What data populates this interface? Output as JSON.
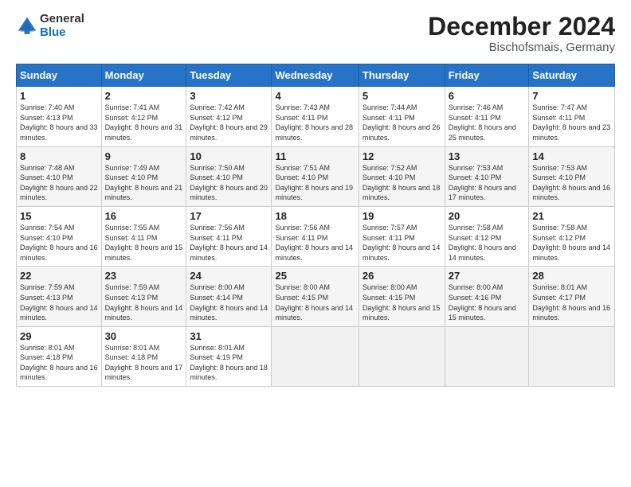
{
  "header": {
    "logo_general": "General",
    "logo_blue": "Blue",
    "title": "December 2024",
    "subtitle": "Bischofsmais, Germany"
  },
  "weekdays": [
    "Sunday",
    "Monday",
    "Tuesday",
    "Wednesday",
    "Thursday",
    "Friday",
    "Saturday"
  ],
  "weeks": [
    [
      {
        "day": "1",
        "sunrise": "7:40 AM",
        "sunset": "4:13 PM",
        "daylight": "8 hours and 33 minutes."
      },
      {
        "day": "2",
        "sunrise": "7:41 AM",
        "sunset": "4:12 PM",
        "daylight": "8 hours and 31 minutes."
      },
      {
        "day": "3",
        "sunrise": "7:42 AM",
        "sunset": "4:12 PM",
        "daylight": "8 hours and 29 minutes."
      },
      {
        "day": "4",
        "sunrise": "7:43 AM",
        "sunset": "4:11 PM",
        "daylight": "8 hours and 28 minutes."
      },
      {
        "day": "5",
        "sunrise": "7:44 AM",
        "sunset": "4:11 PM",
        "daylight": "8 hours and 26 minutes."
      },
      {
        "day": "6",
        "sunrise": "7:46 AM",
        "sunset": "4:11 PM",
        "daylight": "8 hours and 25 minutes."
      },
      {
        "day": "7",
        "sunrise": "7:47 AM",
        "sunset": "4:11 PM",
        "daylight": "8 hours and 23 minutes."
      }
    ],
    [
      {
        "day": "8",
        "sunrise": "7:48 AM",
        "sunset": "4:10 PM",
        "daylight": "8 hours and 22 minutes."
      },
      {
        "day": "9",
        "sunrise": "7:49 AM",
        "sunset": "4:10 PM",
        "daylight": "8 hours and 21 minutes."
      },
      {
        "day": "10",
        "sunrise": "7:50 AM",
        "sunset": "4:10 PM",
        "daylight": "8 hours and 20 minutes."
      },
      {
        "day": "11",
        "sunrise": "7:51 AM",
        "sunset": "4:10 PM",
        "daylight": "8 hours and 19 minutes."
      },
      {
        "day": "12",
        "sunrise": "7:52 AM",
        "sunset": "4:10 PM",
        "daylight": "8 hours and 18 minutes."
      },
      {
        "day": "13",
        "sunrise": "7:53 AM",
        "sunset": "4:10 PM",
        "daylight": "8 hours and 17 minutes."
      },
      {
        "day": "14",
        "sunrise": "7:53 AM",
        "sunset": "4:10 PM",
        "daylight": "8 hours and 16 minutes."
      }
    ],
    [
      {
        "day": "15",
        "sunrise": "7:54 AM",
        "sunset": "4:10 PM",
        "daylight": "8 hours and 16 minutes."
      },
      {
        "day": "16",
        "sunrise": "7:55 AM",
        "sunset": "4:11 PM",
        "daylight": "8 hours and 15 minutes."
      },
      {
        "day": "17",
        "sunrise": "7:56 AM",
        "sunset": "4:11 PM",
        "daylight": "8 hours and 14 minutes."
      },
      {
        "day": "18",
        "sunrise": "7:56 AM",
        "sunset": "4:11 PM",
        "daylight": "8 hours and 14 minutes."
      },
      {
        "day": "19",
        "sunrise": "7:57 AM",
        "sunset": "4:11 PM",
        "daylight": "8 hours and 14 minutes."
      },
      {
        "day": "20",
        "sunrise": "7:58 AM",
        "sunset": "4:12 PM",
        "daylight": "8 hours and 14 minutes."
      },
      {
        "day": "21",
        "sunrise": "7:58 AM",
        "sunset": "4:12 PM",
        "daylight": "8 hours and 14 minutes."
      }
    ],
    [
      {
        "day": "22",
        "sunrise": "7:59 AM",
        "sunset": "4:13 PM",
        "daylight": "8 hours and 14 minutes."
      },
      {
        "day": "23",
        "sunrise": "7:59 AM",
        "sunset": "4:13 PM",
        "daylight": "8 hours and 14 minutes."
      },
      {
        "day": "24",
        "sunrise": "8:00 AM",
        "sunset": "4:14 PM",
        "daylight": "8 hours and 14 minutes."
      },
      {
        "day": "25",
        "sunrise": "8:00 AM",
        "sunset": "4:15 PM",
        "daylight": "8 hours and 14 minutes."
      },
      {
        "day": "26",
        "sunrise": "8:00 AM",
        "sunset": "4:15 PM",
        "daylight": "8 hours and 15 minutes."
      },
      {
        "day": "27",
        "sunrise": "8:00 AM",
        "sunset": "4:16 PM",
        "daylight": "8 hours and 15 minutes."
      },
      {
        "day": "28",
        "sunrise": "8:01 AM",
        "sunset": "4:17 PM",
        "daylight": "8 hours and 16 minutes."
      }
    ],
    [
      {
        "day": "29",
        "sunrise": "8:01 AM",
        "sunset": "4:18 PM",
        "daylight": "8 hours and 16 minutes."
      },
      {
        "day": "30",
        "sunrise": "8:01 AM",
        "sunset": "4:18 PM",
        "daylight": "8 hours and 17 minutes."
      },
      {
        "day": "31",
        "sunrise": "8:01 AM",
        "sunset": "4:19 PM",
        "daylight": "8 hours and 18 minutes."
      },
      null,
      null,
      null,
      null
    ]
  ]
}
